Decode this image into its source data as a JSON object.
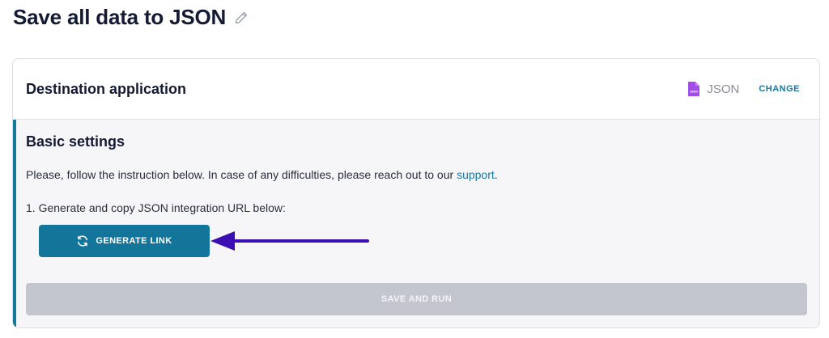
{
  "page": {
    "title": "Save all data to JSON"
  },
  "destination": {
    "title": "Destination application",
    "app_name": "JSON",
    "app_icon_label": "JSON",
    "change_label": "CHANGE"
  },
  "basic_settings": {
    "title": "Basic settings",
    "instruction_prefix": "Please, follow the instruction below. In case of any difficulties, please reach out to our ",
    "support_link": "support",
    "instruction_suffix": ".",
    "step1": "1. Generate and copy JSON integration URL below:",
    "generate_button": "GENERATE LINK"
  },
  "footer": {
    "save_button": "SAVE AND RUN"
  },
  "colors": {
    "accent": "#137599",
    "left_bar": "#137a9c",
    "link": "#1677a0",
    "arrow": "#3c0fb4",
    "json_icon": "#a14de6",
    "disabled_button": "#c3c6ce"
  },
  "icons": {
    "edit": "pencil-icon",
    "json": "json-file-icon",
    "refresh": "refresh-icon",
    "annotation": "arrow-left-annotation"
  }
}
